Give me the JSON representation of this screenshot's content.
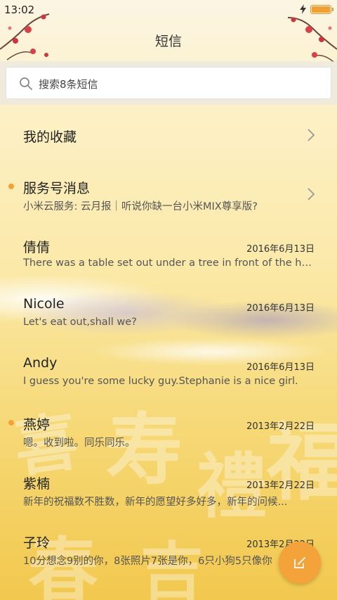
{
  "status": {
    "time": "13:02",
    "battery_level": 1.0
  },
  "header": {
    "title": "短信"
  },
  "search": {
    "text": "搜索8条短信"
  },
  "favorites": {
    "label": "我的收藏"
  },
  "service": {
    "name": "服务号消息",
    "preview": "小米云服务: 云月报｜听说你缺一台小米MIX尊享版?",
    "unread": true
  },
  "conversations": [
    {
      "name": "倩倩",
      "date": "2016年6月13日",
      "preview": "There was a table set out under a tree in front of the ho...",
      "unread": false
    },
    {
      "name": "Nicole",
      "date": "2016年6月13日",
      "preview": "Let's eat out,shall we?",
      "unread": false
    },
    {
      "name": "Andy",
      "date": "2016年6月13日",
      "preview": "I guess you're some lucky guy.Stephanie is a nice girl.",
      "unread": false
    },
    {
      "name": "燕婷",
      "date": "2013年2月22日",
      "preview": "嗯。收到啦。同乐同乐。",
      "unread": true
    },
    {
      "name": "紫楠",
      "date": "2013年2月22日",
      "preview": "新年的祝福数不胜数，新年的愿望好多好多，新年的问候...",
      "unread": false
    },
    {
      "name": "子玲",
      "date": "2013年2月22日",
      "preview": "10分想念9别的你，8张照片7张是你，6只小狗5只像你",
      "unread": false
    }
  ],
  "icons": {
    "search": "search-icon",
    "chevron": "chevron-right-icon",
    "compose": "compose-icon"
  },
  "colors": {
    "accent": "#f4a23a",
    "unread_dot": "#f5a233"
  }
}
